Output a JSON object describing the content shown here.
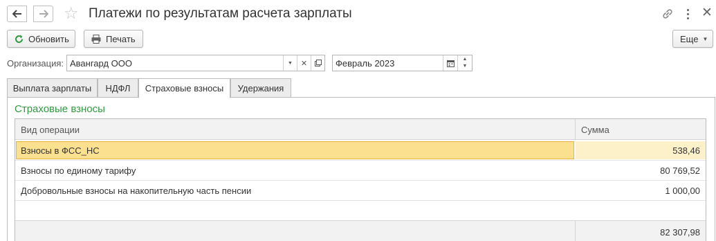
{
  "window": {
    "title": "Платежи по результатам расчета зарплаты"
  },
  "toolbar": {
    "refresh_label": "Обновить",
    "print_label": "Печать",
    "more_label": "Еще"
  },
  "filters": {
    "organization_label": "Организация:",
    "organization_value": "Авангард ООО",
    "period_value": "Февраль 2023"
  },
  "tabs": [
    {
      "label": "Выплата зарплаты"
    },
    {
      "label": "НДФЛ"
    },
    {
      "label": "Страховые взносы",
      "active": true
    },
    {
      "label": "Удержания"
    }
  ],
  "section": {
    "title": "Страховые взносы"
  },
  "table": {
    "columns": [
      "Вид операции",
      "Сумма"
    ],
    "rows": [
      {
        "name": "Взносы в ФСС_НС",
        "sum": "538,46",
        "selected": true
      },
      {
        "name": "Взносы по единому тарифу",
        "sum": "80 769,52"
      },
      {
        "name": "Добровольные взносы на накопительную часть пенсии",
        "sum": "1 000,00"
      }
    ],
    "total": "82 307,98"
  },
  "colors": {
    "accent_green": "#2f9a3e",
    "selection": "#fbe08f"
  }
}
